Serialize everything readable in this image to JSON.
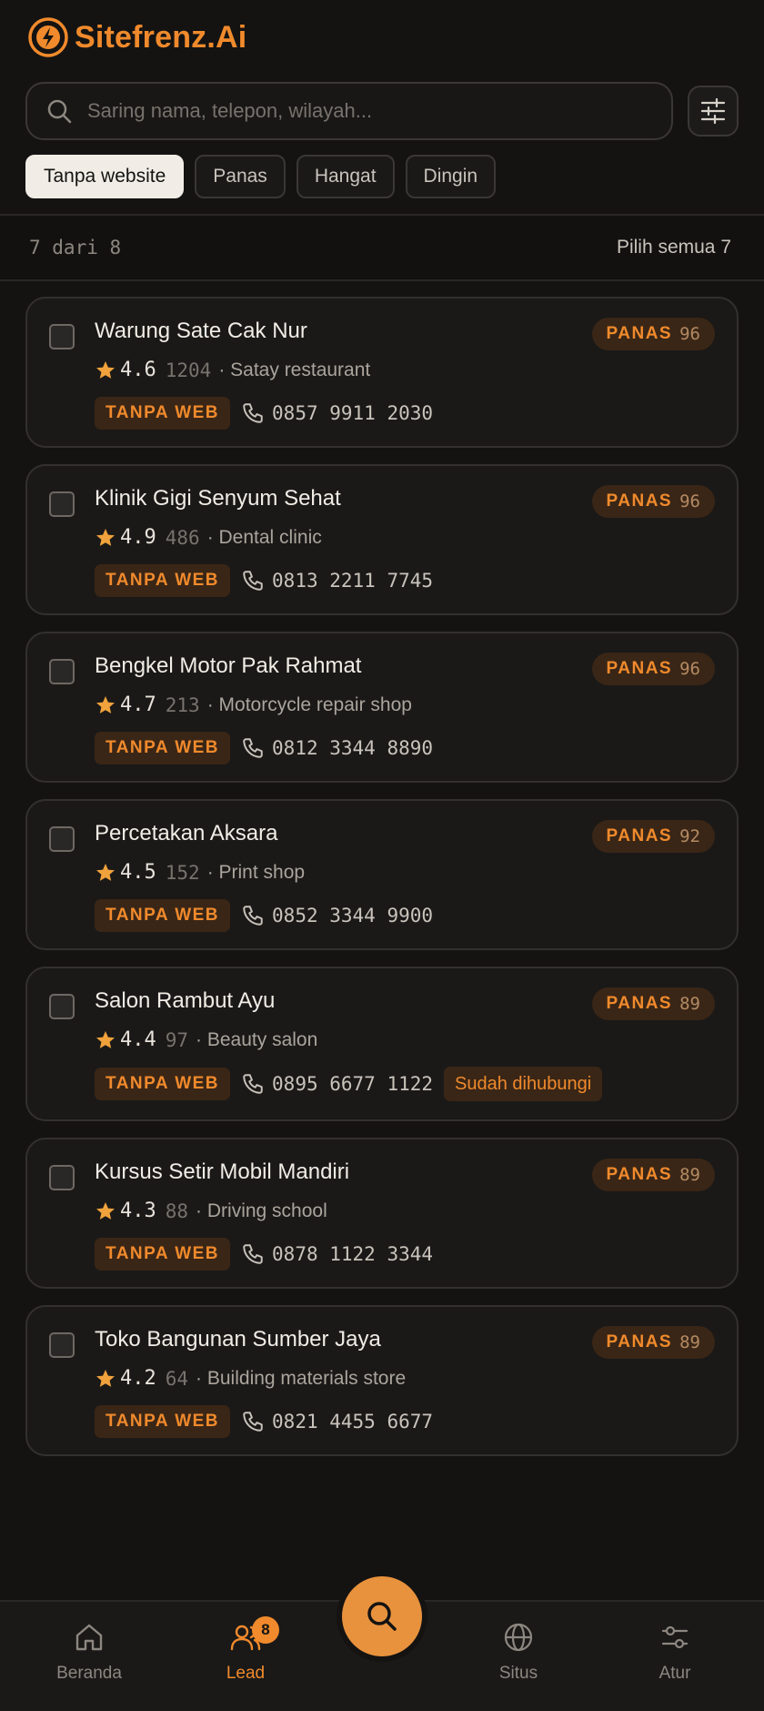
{
  "app": {
    "brand": "Sitefrenz.Ai"
  },
  "search": {
    "placeholder": "Saring nama, telepon, wilayah...",
    "value": ""
  },
  "chips": [
    {
      "label": "Tanpa website",
      "active": true
    },
    {
      "label": "Panas",
      "active": false
    },
    {
      "label": "Hangat",
      "active": false
    },
    {
      "label": "Dingin",
      "active": false
    }
  ],
  "summary": {
    "count": "7 dari 8",
    "select_all": "Pilih semua 7"
  },
  "leads": [
    {
      "name": "Warung Sate Cak Nur",
      "score_label": "PANAS",
      "score": "96",
      "rating": "4.6",
      "reviews": "1204",
      "category": "· Satay restaurant",
      "web_badge": "TANPA WEB",
      "phone": "0857 9911 2030",
      "status": ""
    },
    {
      "name": "Klinik Gigi Senyum Sehat",
      "score_label": "PANAS",
      "score": "96",
      "rating": "4.9",
      "reviews": "486",
      "category": "· Dental clinic",
      "web_badge": "TANPA WEB",
      "phone": "0813 2211 7745",
      "status": ""
    },
    {
      "name": "Bengkel Motor Pak Rahmat",
      "score_label": "PANAS",
      "score": "96",
      "rating": "4.7",
      "reviews": "213",
      "category": "· Motorcycle repair shop",
      "web_badge": "TANPA WEB",
      "phone": "0812 3344 8890",
      "status": ""
    },
    {
      "name": "Percetakan Aksara",
      "score_label": "PANAS",
      "score": "92",
      "rating": "4.5",
      "reviews": "152",
      "category": "· Print shop",
      "web_badge": "TANPA WEB",
      "phone": "0852 3344 9900",
      "status": ""
    },
    {
      "name": "Salon Rambut Ayu",
      "score_label": "PANAS",
      "score": "89",
      "rating": "4.4",
      "reviews": "97",
      "category": "· Beauty salon",
      "web_badge": "TANPA WEB",
      "phone": "0895 6677 1122",
      "status": "Sudah dihubungi"
    },
    {
      "name": "Kursus Setir Mobil Mandiri",
      "score_label": "PANAS",
      "score": "89",
      "rating": "4.3",
      "reviews": "88",
      "category": "· Driving school",
      "web_badge": "TANPA WEB",
      "phone": "0878 1122 3344",
      "status": ""
    },
    {
      "name": "Toko Bangunan Sumber Jaya",
      "score_label": "PANAS",
      "score": "89",
      "rating": "4.2",
      "reviews": "64",
      "category": "· Building materials store",
      "web_badge": "TANPA WEB",
      "phone": "0821 4455 6677",
      "status": ""
    }
  ],
  "nav": {
    "home": "Beranda",
    "lead": "Lead",
    "lead_badge": "8",
    "sites": "Situs",
    "settings": "Atur"
  },
  "colors": {
    "accent": "#f08a2c",
    "background": "#141312",
    "card": "#1a1918",
    "star": "#f0a23c"
  },
  "icons": [
    "logo-icon",
    "search-icon",
    "sliders-icon",
    "star-icon",
    "phone-icon",
    "home-icon",
    "users-icon",
    "globe-icon",
    "settings-icon"
  ]
}
